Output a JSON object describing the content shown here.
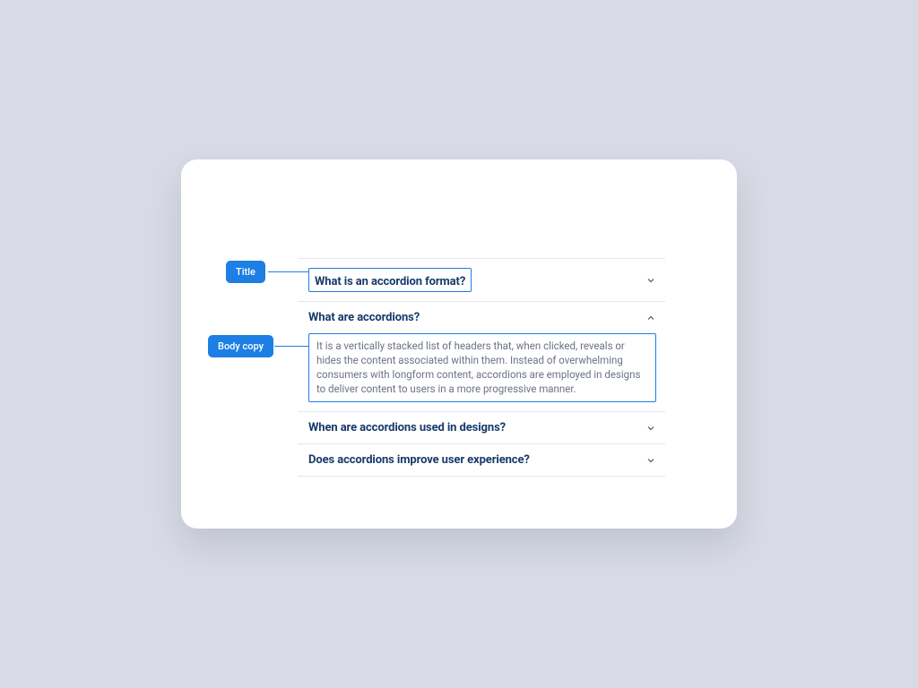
{
  "annotations": {
    "title_tag": "Title",
    "body_tag": "Body copy"
  },
  "accordion": {
    "items": [
      {
        "title": "What is an accordion format?",
        "expanded": false,
        "highlighted": "title"
      },
      {
        "title": "What are accordions?",
        "expanded": true,
        "highlighted": "body",
        "body": "It is a vertically stacked list of headers that, when clicked, reveals or hides the content associated within them. Instead of overwhelming consumers with longform content, accordions are employed in designs to deliver content to users in a more progressive manner."
      },
      {
        "title": "When are accordions used in designs?",
        "expanded": false
      },
      {
        "title": "Does accordions improve user experience?",
        "expanded": false
      }
    ]
  },
  "colors": {
    "accent": "#1d7ee3",
    "heading": "#173a6a",
    "body_text": "#6a7385"
  }
}
